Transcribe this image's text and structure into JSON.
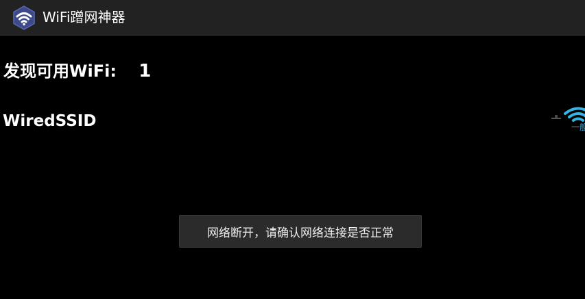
{
  "app_bar": {
    "title": "WiFi蹭网神器",
    "icon": "wifi-hexagon-icon"
  },
  "summary": {
    "found_label": "发现可用WiFi:",
    "found_count": "1"
  },
  "networks": [
    {
      "ssid": "WiredSSID",
      "signal_icon": "wifi-signal-icon",
      "signal_text": "一般"
    }
  ],
  "toast": {
    "message": "网络断开，请确认网络连接是否正常"
  },
  "colors": {
    "background": "#000000",
    "action_bar": "#222222",
    "accent_blue": "#33b5e5",
    "icon_hexagon": "#3c4a8c"
  }
}
